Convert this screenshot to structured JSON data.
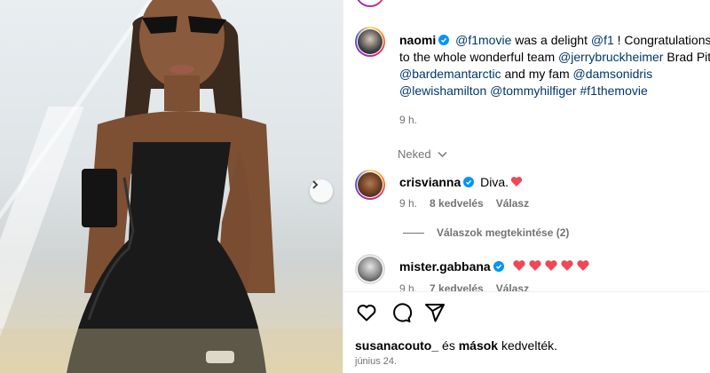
{
  "post": {
    "author": "naomi",
    "caption_parts": [
      {
        "text": "@f1movie",
        "link": true
      },
      {
        "text": " was a delight ",
        "link": false
      },
      {
        "text": "@f1",
        "link": true
      },
      {
        "text": " ! Congratulations to the whole wonderful team ",
        "link": false
      },
      {
        "text": "@jerrybruckheimer",
        "link": true
      },
      {
        "text": " Brad Pitt ",
        "link": false
      },
      {
        "text": "@bardemantarctic",
        "link": true
      },
      {
        "text": " and my fam ",
        "link": false
      },
      {
        "text": "@damsonidris",
        "link": true
      },
      {
        "text": " ",
        "link": false
      },
      {
        "text": "@lewishamilton",
        "link": true
      },
      {
        "text": " ",
        "link": false
      },
      {
        "text": "@tommyhilfiger",
        "link": true
      },
      {
        "text": " ",
        "link": false
      },
      {
        "text": "#f1themovie",
        "link": true
      }
    ],
    "time": "9 h."
  },
  "following_label": "Neked",
  "comments": [
    {
      "user": "crisvianna",
      "text": "Diva.",
      "hearts": 1,
      "time": "9 h.",
      "likes": "8 kedvelés",
      "reply": "Válasz",
      "view_replies": "Válaszok megtekintése (2)"
    },
    {
      "user": "mister.gabbana",
      "text": "",
      "hearts": 5,
      "time": "9 h.",
      "likes": "7 kedvelés",
      "reply": "Válasz"
    }
  ],
  "liked_by": {
    "user": "susanacouto_",
    "and": "és",
    "others": "mások",
    "suffix": "kedvelték."
  },
  "date": "június 24.",
  "colors": {
    "link": "#00376b",
    "verified": "#0095f6",
    "heart": "#ed4956",
    "muted": "#737373"
  },
  "icons": {
    "like": "heart-outline-icon",
    "comment": "comment-bubble-icon",
    "share": "paper-plane-icon",
    "next": "chevron-right-icon",
    "following_toggle": "chevron-down-icon"
  }
}
